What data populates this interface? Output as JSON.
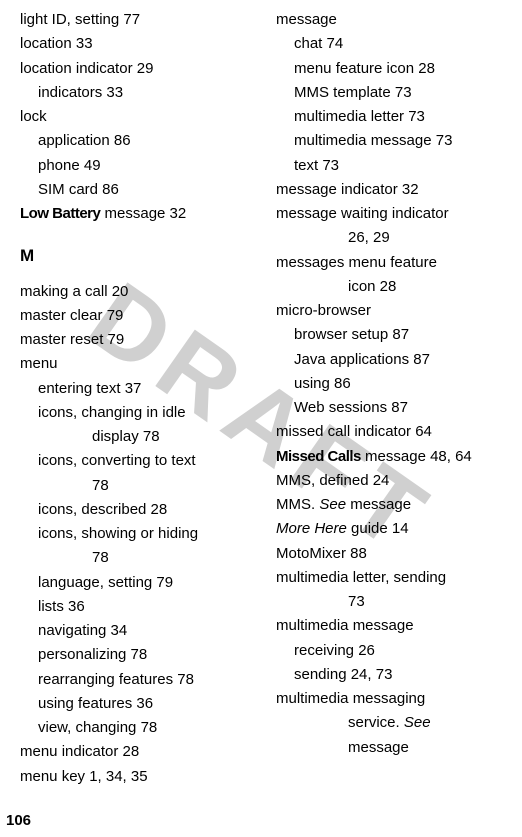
{
  "watermark": "DRAFT",
  "pageNumber": "106",
  "leftColumn": [
    {
      "text": "light ID, setting  77",
      "cls": "entry"
    },
    {
      "text": "location  33",
      "cls": "entry"
    },
    {
      "text": "location indicator  29",
      "cls": "entry"
    },
    {
      "text": "indicators  33",
      "cls": "entry sub1"
    },
    {
      "text": "lock",
      "cls": "entry"
    },
    {
      "text": "application  86",
      "cls": "entry sub1"
    },
    {
      "text": "phone  49",
      "cls": "entry sub1"
    },
    {
      "text": "SIM card  86",
      "cls": "entry sub1"
    },
    {
      "prefix": "Low Battery",
      "prefixClass": "bold-label",
      "text": " message  32",
      "cls": "entry"
    }
  ],
  "leftHeading": "M",
  "leftColumn2": [
    {
      "text": "making a call  20",
      "cls": "entry"
    },
    {
      "text": "master clear  79",
      "cls": "entry"
    },
    {
      "text": "master reset  79",
      "cls": "entry"
    },
    {
      "text": "menu",
      "cls": "entry"
    },
    {
      "text": "entering text  37",
      "cls": "entry sub1"
    },
    {
      "text": "icons, changing in idle",
      "cls": "entry sub1"
    },
    {
      "text": "display  78",
      "cls": "entry sub2"
    },
    {
      "text": "icons, converting to text",
      "cls": "entry sub1"
    },
    {
      "text": "78",
      "cls": "entry sub2"
    },
    {
      "text": "icons, described  28",
      "cls": "entry sub1"
    },
    {
      "text": "icons, showing or hiding",
      "cls": "entry sub1"
    },
    {
      "text": "78",
      "cls": "entry sub2"
    },
    {
      "text": "language, setting  79",
      "cls": "entry sub1"
    },
    {
      "text": "lists  36",
      "cls": "entry sub1"
    },
    {
      "text": "navigating  34",
      "cls": "entry sub1"
    },
    {
      "text": "personalizing  78",
      "cls": "entry sub1"
    },
    {
      "text": "rearranging features  78",
      "cls": "entry sub1"
    },
    {
      "text": "using features  36",
      "cls": "entry sub1"
    },
    {
      "text": "view, changing  78",
      "cls": "entry sub1"
    },
    {
      "text": "menu indicator  28",
      "cls": "entry"
    },
    {
      "text": "menu key  1, 34, 35",
      "cls": "entry"
    }
  ],
  "rightColumn": [
    {
      "text": "message",
      "cls": "entry"
    },
    {
      "text": "chat  74",
      "cls": "entry sub1"
    },
    {
      "text": "menu feature icon  28",
      "cls": "entry sub1"
    },
    {
      "text": "MMS template  73",
      "cls": "entry sub1"
    },
    {
      "text": "multimedia letter  73",
      "cls": "entry sub1"
    },
    {
      "text": "multimedia message  73",
      "cls": "entry sub1"
    },
    {
      "text": "text  73",
      "cls": "entry sub1"
    },
    {
      "text": "message indicator  32",
      "cls": "entry"
    },
    {
      "text": "message waiting indicator",
      "cls": "entry"
    },
    {
      "text": "26, 29",
      "cls": "entry sub2"
    },
    {
      "text": "messages menu feature",
      "cls": "entry"
    },
    {
      "text": "icon  28",
      "cls": "entry sub2"
    },
    {
      "text": "micro-browser",
      "cls": "entry"
    },
    {
      "text": "browser setup  87",
      "cls": "entry sub1"
    },
    {
      "text": "Java applications  87",
      "cls": "entry sub1"
    },
    {
      "text": "using  86",
      "cls": "entry sub1"
    },
    {
      "text": "Web sessions  87",
      "cls": "entry sub1"
    },
    {
      "text": "missed call indicator  64",
      "cls": "entry"
    },
    {
      "prefix": "Missed Calls",
      "prefixClass": "bold-label",
      "text": " message  48, 64",
      "cls": "entry"
    },
    {
      "text": "MMS, defined  24",
      "cls": "entry"
    },
    {
      "parts": [
        {
          "text": "MMS. "
        },
        {
          "text": "See",
          "cls": "italic"
        },
        {
          "text": " message"
        }
      ],
      "cls": "entry"
    },
    {
      "parts": [
        {
          "text": "More Here",
          "cls": "italic"
        },
        {
          "text": " guide  14"
        }
      ],
      "cls": "entry"
    },
    {
      "text": "MotoMixer  88",
      "cls": "entry"
    },
    {
      "text": "multimedia letter, sending",
      "cls": "entry"
    },
    {
      "text": "73",
      "cls": "entry sub2"
    },
    {
      "text": "multimedia message",
      "cls": "entry"
    },
    {
      "text": "receiving  26",
      "cls": "entry sub1"
    },
    {
      "text": "sending  24, 73",
      "cls": "entry sub1"
    },
    {
      "text": "multimedia messaging",
      "cls": "entry"
    },
    {
      "parts": [
        {
          "text": "service. "
        },
        {
          "text": "See",
          "cls": "italic"
        }
      ],
      "cls": "entry sub2"
    },
    {
      "text": "message",
      "cls": "entry sub2"
    }
  ]
}
